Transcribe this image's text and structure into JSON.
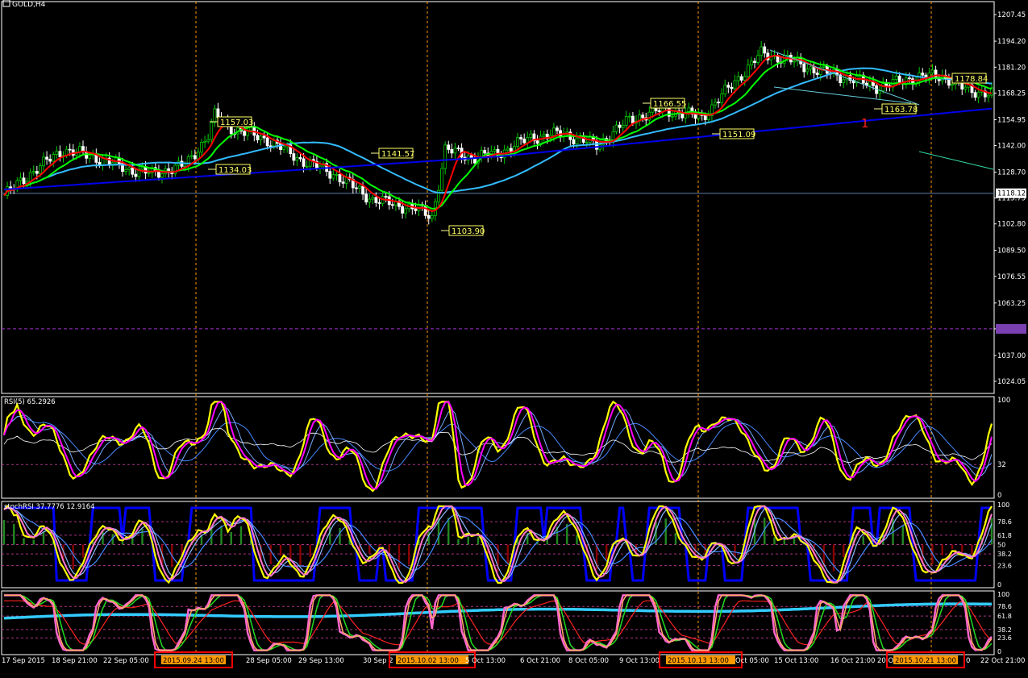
{
  "window_title": "GOLD,H4",
  "colors": {
    "background": "#000000",
    "frame": "#ffffff",
    "bull_candle": "#00cc00",
    "bear_candle": "#ffffff",
    "ma_red": "#ff0000",
    "ma_green": "#00ff00",
    "ma_cyan": "#33bbff",
    "ma_blue": "#0000ee",
    "time_marker": "#ff9900",
    "rsi_yellow": "#ffff00",
    "rsi_magenta": "#ff00ff",
    "stoch_blue": "#0000ff",
    "label_bg": "#ffff99",
    "highlight_box": "#ff0000"
  },
  "main_panel": {
    "price_axis": [
      "1207.45",
      "1194.20",
      "1181.20",
      "1168.25",
      "1154.95",
      "1142.00",
      "1128.70",
      "1115.75",
      "1102.80",
      "1089.50",
      "1076.55",
      "1063.25",
      "1050.30",
      "1037.00",
      "1024.05"
    ],
    "current_price": "1118.12",
    "marked_level": "1050.30",
    "price_labels": [
      {
        "id": "l1157",
        "text": "1157.03"
      },
      {
        "id": "l1134",
        "text": "1134.03"
      },
      {
        "id": "l1141",
        "text": "1141.57"
      },
      {
        "id": "l1103",
        "text": "1103.90"
      },
      {
        "id": "l1166",
        "text": "1166.55"
      },
      {
        "id": "l1151",
        "text": "1151.09"
      },
      {
        "id": "l1178",
        "text": "1178.84"
      },
      {
        "id": "l1163",
        "text": "1163.78"
      }
    ],
    "annotation": "1"
  },
  "rsi_panel": {
    "title": "RSI(5) 65.2926",
    "axis": [
      "100",
      "32",
      "0"
    ]
  },
  "stoch_panel": {
    "title": "stochRSI 37.7776 12.9164",
    "axis": [
      "100",
      "78.6",
      "61.8",
      "50",
      "38.2",
      "23.6",
      "0"
    ]
  },
  "stoch2_panel": {
    "axis": [
      "100",
      "78.6",
      "61.8",
      "38.2",
      "23.6",
      "0"
    ]
  },
  "time_axis": [
    "17 Sep 2015",
    "18 Sep 21:00",
    "22 Sep 05:00",
    "2015.09.24 13:00",
    "28 Sep 05:00",
    "29 Sep 13:00",
    "30 Sep 2",
    "2015.10.02 13:00",
    "5 Oct 13:00",
    "6 Oct 21:00",
    "8 Oct 05:00",
    "9 Oct 13:00",
    "2015.10.13 13:00",
    "Oct 05:00",
    "15 Oct 13:00",
    "16 Oct 21:00",
    "20 Oct",
    "2015.10.21 13:00",
    "0",
    "22 Oct 21:00"
  ],
  "chart_data": {
    "type": "line",
    "symbol": "GOLD",
    "timeframe": "H4",
    "ylim": [
      1018,
      1214
    ],
    "x": [
      "17 Sep 2015",
      "18 Sep 21:00",
      "22 Sep 05:00",
      "2015.09.24 13:00",
      "28 Sep 05:00",
      "29 Sep 13:00",
      "2015.10.02 13:00",
      "5 Oct 13:00",
      "6 Oct 21:00",
      "8 Oct 05:00",
      "9 Oct 13:00",
      "2015.10.13 13:00",
      "15 Oct 13:00",
      "16 Oct 21:00",
      "2015.10.21 13:00",
      "22 Oct 21:00"
    ],
    "price_path": [
      [
        0,
        1117
      ],
      [
        8,
        1128
      ],
      [
        18,
        1140
      ],
      [
        28,
        1136
      ],
      [
        38,
        1130
      ],
      [
        45,
        1128
      ],
      [
        55,
        1132
      ],
      [
        62,
        1147
      ],
      [
        64,
        1157
      ],
      [
        70,
        1150
      ],
      [
        80,
        1145
      ],
      [
        90,
        1135
      ],
      [
        100,
        1128
      ],
      [
        112,
        1115
      ],
      [
        126,
        1110
      ],
      [
        130,
        1106
      ],
      [
        134,
        1140
      ],
      [
        142,
        1136
      ],
      [
        150,
        1138
      ],
      [
        160,
        1146
      ],
      [
        170,
        1148
      ],
      [
        180,
        1142
      ],
      [
        190,
        1155
      ],
      [
        200,
        1160
      ],
      [
        212,
        1156
      ],
      [
        222,
        1174
      ],
      [
        230,
        1188
      ],
      [
        238,
        1185
      ],
      [
        246,
        1180
      ],
      [
        256,
        1176
      ],
      [
        266,
        1171
      ],
      [
        276,
        1176
      ],
      [
        285,
        1177
      ],
      [
        292,
        1170
      ],
      [
        300,
        1168
      ]
    ],
    "support_level": 1118.12,
    "series": [
      {
        "name": "RSI(5)",
        "last": 65.2926
      },
      {
        "name": "stochRSI",
        "values": [
          37.7776,
          12.9164
        ]
      }
    ]
  }
}
